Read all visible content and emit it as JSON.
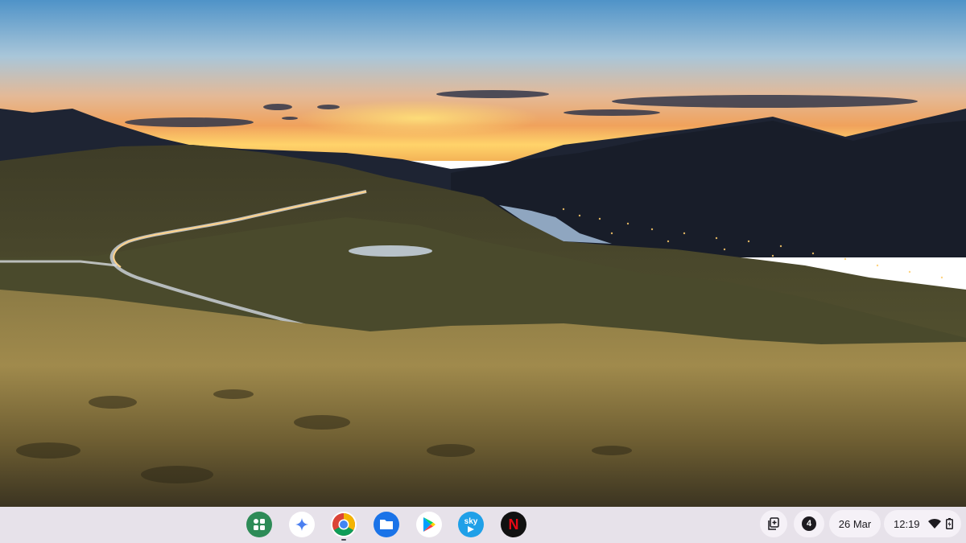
{
  "shelf": {
    "apps": [
      {
        "name": "Launcher",
        "icon": "launcher-icon"
      },
      {
        "name": "Gemini",
        "icon": "gemini-icon"
      },
      {
        "name": "Chrome",
        "icon": "chrome-icon",
        "running": true
      },
      {
        "name": "Files",
        "icon": "files-icon"
      },
      {
        "name": "Play Store",
        "icon": "play-store-icon"
      },
      {
        "name": "Sky Go",
        "icon": "sky-icon",
        "label": "sky"
      },
      {
        "name": "Netflix",
        "icon": "netflix-icon",
        "label": "N"
      }
    ]
  },
  "tray": {
    "notification_count": "4",
    "date": "26 Mar",
    "time": "12:19",
    "icons": [
      "clipboard-icon",
      "wifi-icon",
      "battery-icon"
    ]
  },
  "wallpaper": {
    "description_icon": "landscape-wallpaper"
  },
  "colors": {
    "shelf_bg": "#e7e2ea",
    "pill_bg": "#f5f1f7"
  }
}
